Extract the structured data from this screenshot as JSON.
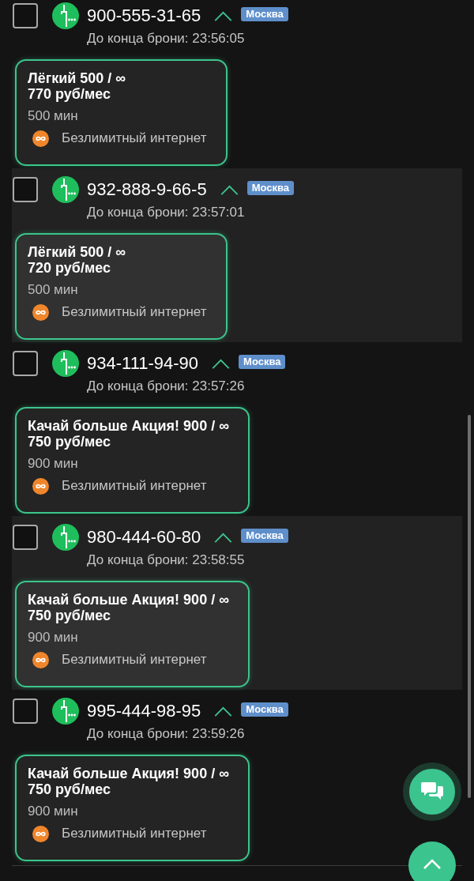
{
  "items": [
    {
      "checked": false,
      "phone": "900-555-31-65",
      "expanded": true,
      "region": "Москва",
      "timer": "До конца брони: 23:56:05",
      "tariff": {
        "name": "Лёгкий 500 / ∞",
        "price": "770 руб/мес",
        "minutes": "500 мин",
        "internet": "Безлимитный интернет"
      }
    },
    {
      "checked": false,
      "phone": "932-888-9-66-5",
      "expanded": true,
      "region": "Москва",
      "timer": "До конца брони: 23:57:01",
      "tariff": {
        "name": "Лёгкий 500 / ∞",
        "price": "720 руб/мес",
        "minutes": "500 мин",
        "internet": "Безлимитный интернет"
      }
    },
    {
      "checked": false,
      "phone": "934-111-94-90",
      "expanded": true,
      "region": "Москва",
      "timer": "До конца брони: 23:57:26",
      "tariff": {
        "name": "Качай больше Акция! 900 / ∞",
        "price": "750 руб/мес",
        "minutes": "900 мин",
        "internet": "Безлимитный интернет"
      }
    },
    {
      "checked": false,
      "phone": "980-444-60-80",
      "expanded": true,
      "region": "Москва",
      "timer": "До конца брони: 23:58:55",
      "tariff": {
        "name": "Качай больше Акция! 900 / ∞",
        "price": "750 руб/мес",
        "minutes": "900 мин",
        "internet": "Безлимитный интернет"
      }
    },
    {
      "checked": false,
      "phone": "995-444-98-95",
      "expanded": true,
      "region": "Москва",
      "timer": "До конца брони: 23:59:26",
      "tariff": {
        "name": "Качай больше Акция! 900 / ∞",
        "price": "750 руб/мес",
        "minutes": "900 мин",
        "internet": "Безлимитный интернет"
      }
    }
  ]
}
